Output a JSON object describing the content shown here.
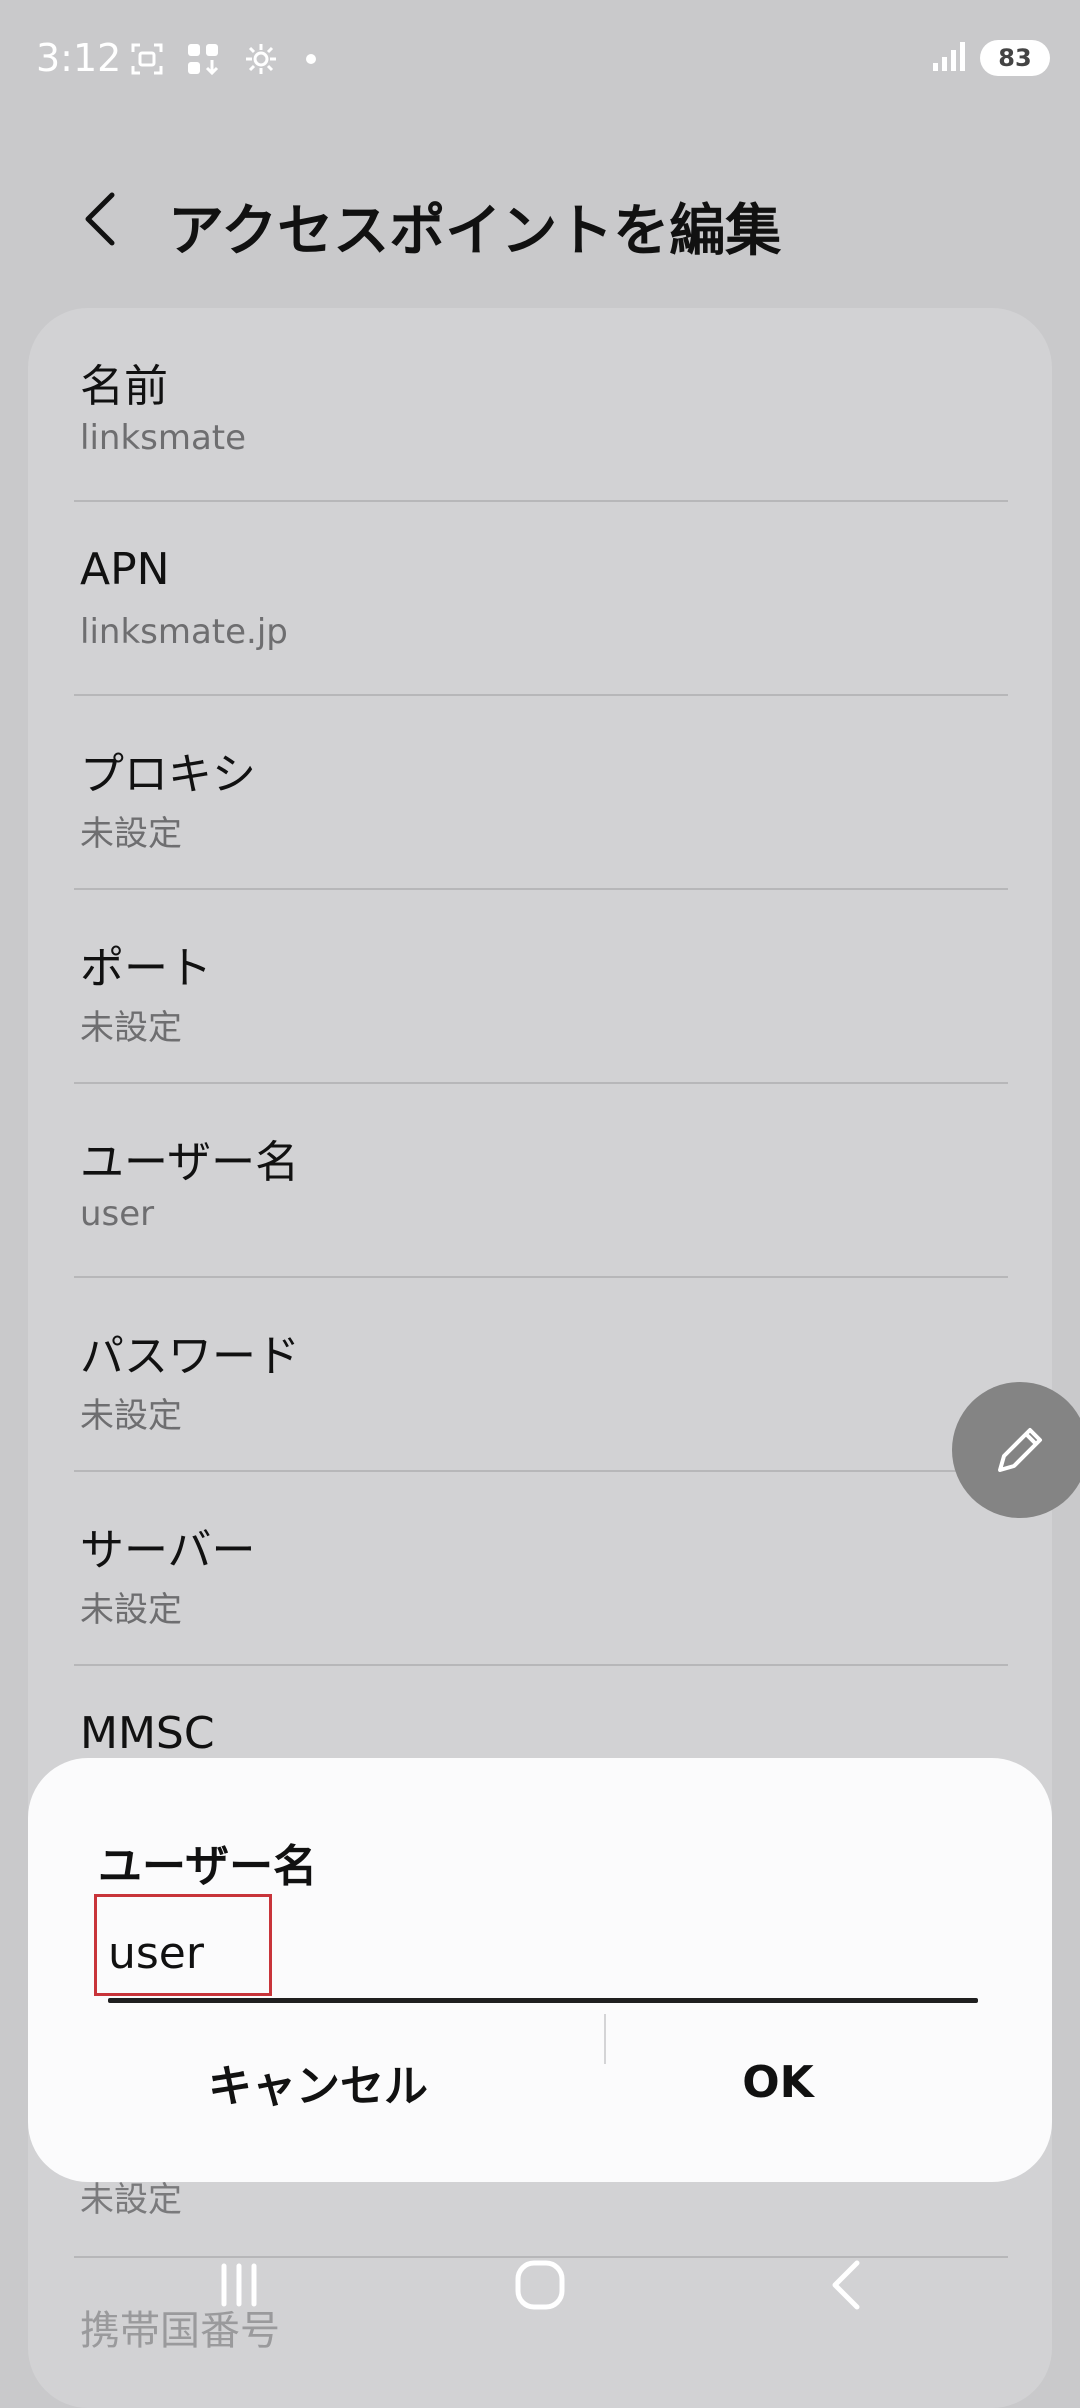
{
  "status_bar": {
    "time": "3:12",
    "battery": "83"
  },
  "header": {
    "title": "アクセスポイントを編集"
  },
  "list": [
    {
      "label": "名前",
      "value": "linksmate"
    },
    {
      "label": "APN",
      "value": "linksmate.jp"
    },
    {
      "label": "プロキシ",
      "value": "未設定"
    },
    {
      "label": "ポート",
      "value": "未設定"
    },
    {
      "label": "ユーザー名",
      "value": "user"
    },
    {
      "label": "パスワード",
      "value": "未設定"
    },
    {
      "label": "サーバー",
      "value": "未設定"
    },
    {
      "label": "MMSC",
      "value": ""
    }
  ],
  "peek": {
    "value": "未設定",
    "label": "携帯国番号"
  },
  "dialog": {
    "title": "ユーザー名",
    "input_value": "user",
    "cancel_label": "キャンセル",
    "ok_label": "OK"
  },
  "colors": {
    "background_dim": "#c9c9cb",
    "card": "#d2d2d4",
    "dialog": "#fbfbfc",
    "highlight_border": "#c8343a",
    "fab": "#848484"
  }
}
